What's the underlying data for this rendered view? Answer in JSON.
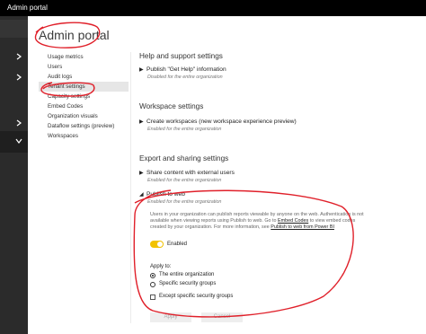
{
  "topbar": {
    "app_title": "Admin portal"
  },
  "page": {
    "title": "Admin portal"
  },
  "nav": {
    "items": [
      {
        "label": "Usage metrics",
        "active": false
      },
      {
        "label": "Users",
        "active": false
      },
      {
        "label": "Audit logs",
        "active": false
      },
      {
        "label": "Tenant settings",
        "active": true
      },
      {
        "label": "Capacity settings",
        "active": false
      },
      {
        "label": "Embed Codes",
        "active": false
      },
      {
        "label": "Organization visuals",
        "active": false
      },
      {
        "label": "Dataflow settings (preview)",
        "active": false
      },
      {
        "label": "Workspaces",
        "active": false
      }
    ]
  },
  "sections": {
    "help": {
      "heading": "Help and support settings",
      "item_label": "Publish \"Get Help\" information",
      "item_status": "Disabled for the entire organization"
    },
    "workspace": {
      "heading": "Workspace settings",
      "item_label": "Create workspaces (new workspace experience preview)",
      "item_status": "Enabled for the entire organization"
    },
    "export": {
      "heading": "Export and sharing settings",
      "share_label": "Share content with external users",
      "share_status": "Enabled for the entire organization",
      "publish_label": "Publish to web",
      "publish_status": "Enabled for the entire organization",
      "desc_1": "Users in your organization can publish reports viewable by anyone on the web. Authentication is not available when viewing reports using Publish to web. Go to ",
      "desc_link_1": "Embed Codes",
      "desc_2": " to view embed codes created by your organization. For more information, see ",
      "desc_link_2": "Publish to web from Power BI",
      "toggle_label": "Enabled",
      "toggle_on": true,
      "apply_to_label": "Apply to:",
      "option_entire": "The entire organization",
      "option_specific": "Specific security groups",
      "except_label": "Except specific security groups",
      "apply_button": "Apply",
      "cancel_button": "Cancel"
    }
  },
  "colors": {
    "topbar": "#000000",
    "rail": "#2b2b2b",
    "toggle_on": "#f2c200",
    "annotation": "#e0202a"
  },
  "icons": {
    "rail_chevrons": [
      "chevron-right-icon",
      "chevron-right-icon",
      "chevron-right-icon",
      "chevron-down-icon"
    ]
  }
}
